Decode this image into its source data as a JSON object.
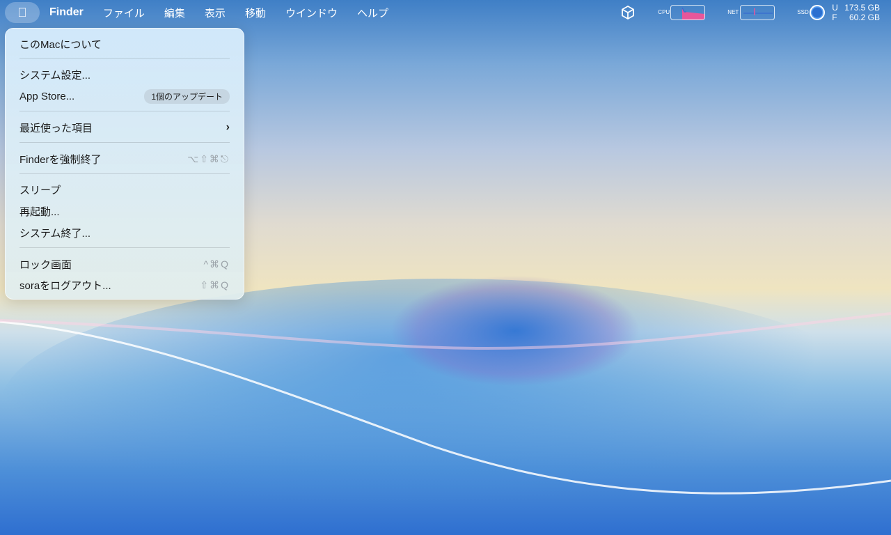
{
  "menubar": {
    "apple": "",
    "app": "Finder",
    "menus": [
      "ファイル",
      "編集",
      "表示",
      "移動",
      "ウインドウ",
      "ヘルプ"
    ]
  },
  "status": {
    "cpu_label": "CPU",
    "net_label": "NET",
    "ssd_label": "SSD",
    "used_label": "U",
    "used": "173.5 GB",
    "free_label": "F",
    "free": "60.2 GB",
    "cpu_color": "#e8569a"
  },
  "apple_menu": {
    "about": "このMacについて",
    "settings": "システム設定...",
    "appstore": "App Store...",
    "appstore_badge": "1個のアップデート",
    "recent": "最近使った項目",
    "recent_arrow": "›",
    "force_quit": "Finderを強制終了",
    "force_quit_shortcut": "⌥⇧⌘⎋",
    "sleep": "スリープ",
    "restart": "再起動...",
    "shutdown": "システム終了...",
    "lock": "ロック画面",
    "lock_shortcut": "^⌘Q",
    "logout": "soraをログアウト...",
    "logout_shortcut": "⇧⌘Q"
  }
}
